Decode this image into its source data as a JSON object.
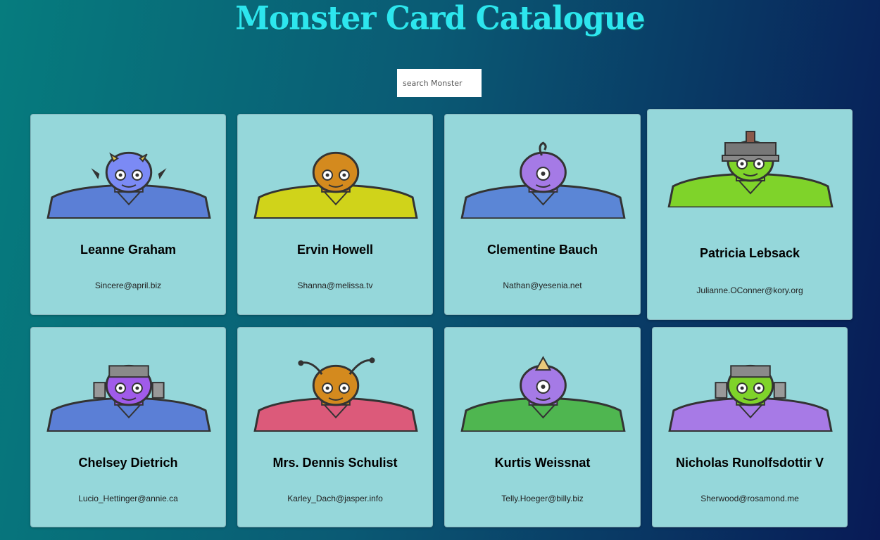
{
  "header": {
    "title": "Monster Card Catalogue"
  },
  "search": {
    "placeholder": "search Monster"
  },
  "cards": [
    {
      "name": "Leanne Graham",
      "email": "Sincere@april.biz",
      "head": "#7b8af5",
      "body": "#5b7fd6",
      "feature": "horns-yellow"
    },
    {
      "name": "Ervin Howell",
      "email": "Shanna@melissa.tv",
      "head": "#d48a1e",
      "body": "#d0d31a",
      "feature": "bald"
    },
    {
      "name": "Clementine Bauch",
      "email": "Nathan@yesenia.net",
      "head": "#a57ae6",
      "body": "#5b86d6",
      "feature": "cyclops-antenna"
    },
    {
      "name": "Patricia Lebsack",
      "email": "Julianne.OConner@kory.org",
      "head": "#7fd32a",
      "body": "#7fd32a",
      "feature": "helmet"
    },
    {
      "name": "Chelsey Dietrich",
      "email": "Lucio_Hettinger@annie.ca",
      "head": "#a05bea",
      "body": "#5b7fd6",
      "feature": "robot-helmet"
    },
    {
      "name": "Mrs. Dennis Schulist",
      "email": "Karley_Dach@jasper.info",
      "head": "#d48a1e",
      "body": "#dc5a7a",
      "feature": "antennae"
    },
    {
      "name": "Kurtis Weissnat",
      "email": "Telly.Hoeger@billy.biz",
      "head": "#a57ae6",
      "body": "#4fb650",
      "feature": "cyclops-horn"
    },
    {
      "name": "Nicholas Runolfsdottir V",
      "email": "Sherwood@rosamond.me",
      "head": "#7fd32a",
      "body": "#a77ae6",
      "feature": "robot-helmet"
    }
  ]
}
